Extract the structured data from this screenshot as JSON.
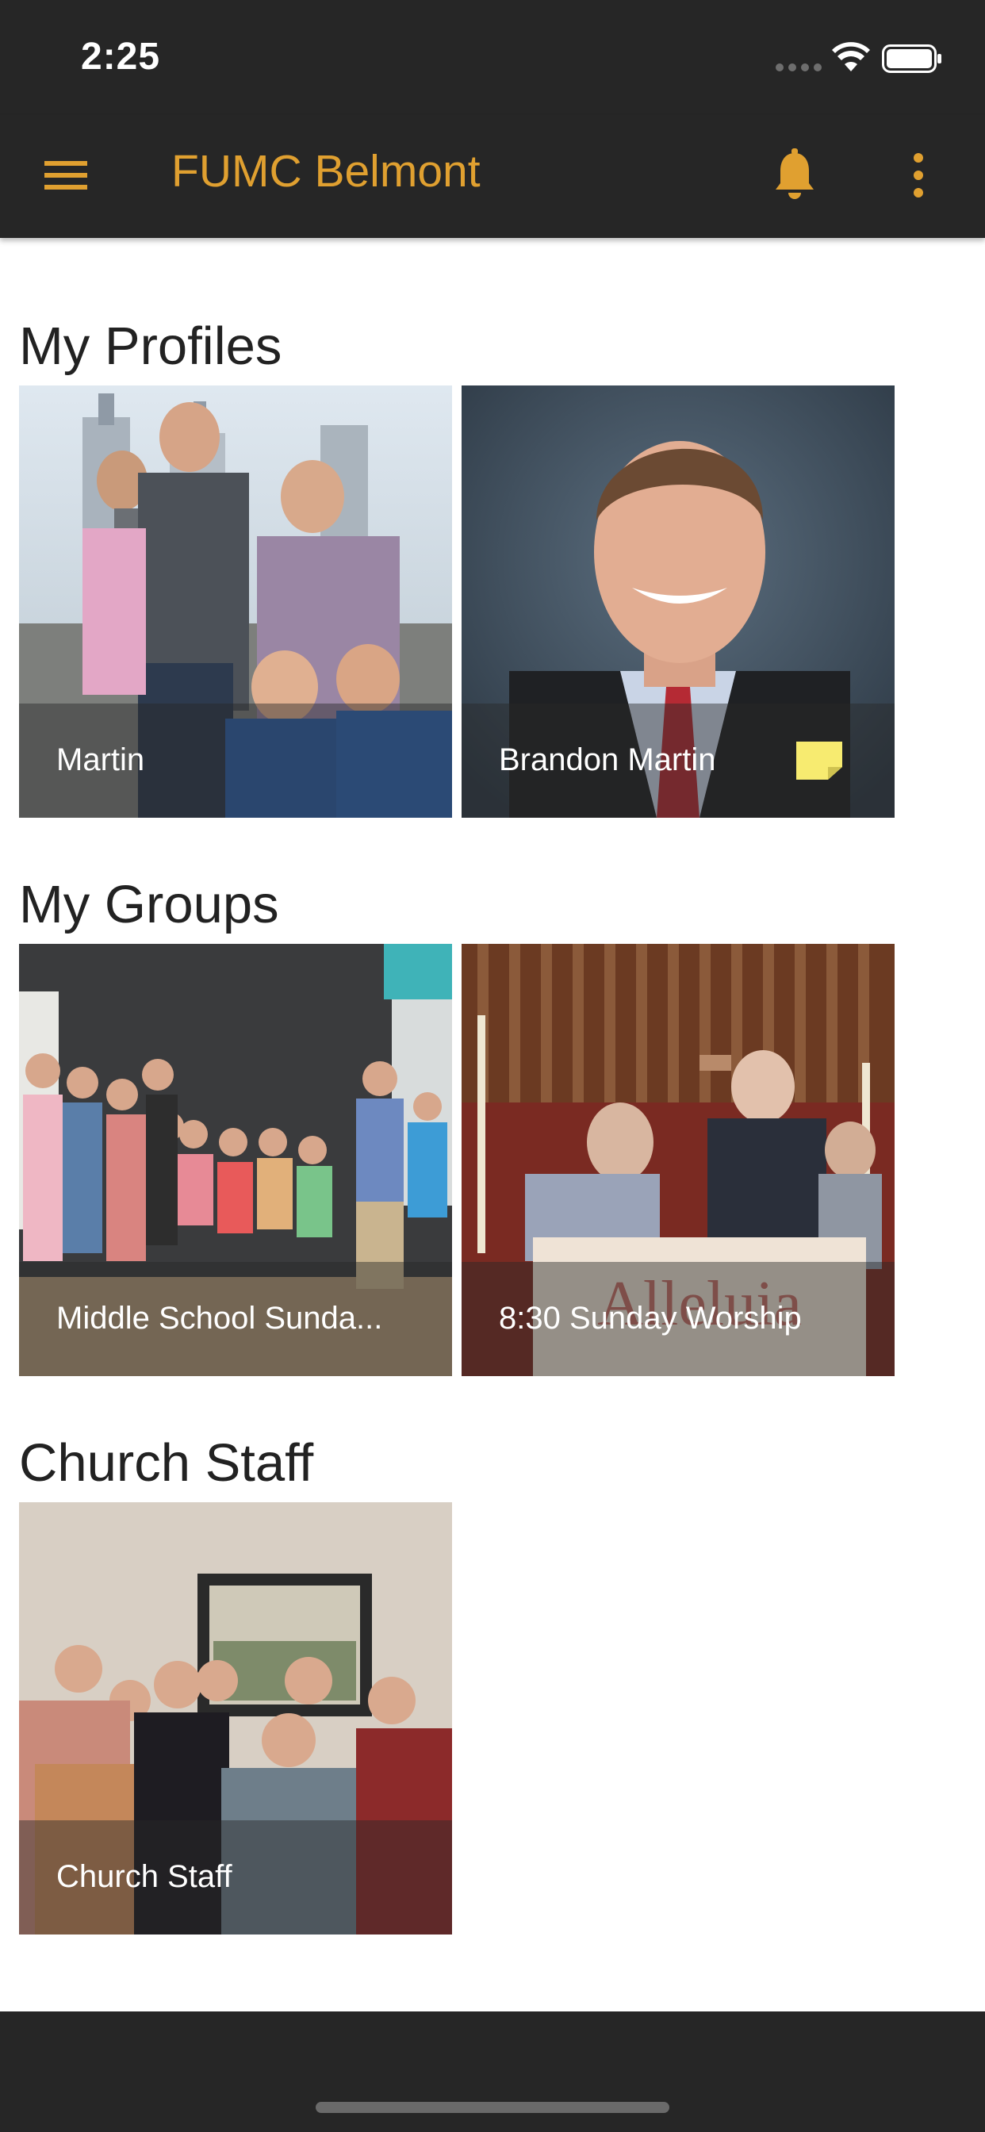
{
  "status_bar": {
    "time": "2:25"
  },
  "app_bar": {
    "title": "FUMC Belmont",
    "accent_color": "#e0a030",
    "icons": [
      "menu-icon",
      "bell-icon",
      "more-vertical-icon"
    ]
  },
  "sections": {
    "profiles": {
      "title": "My Profiles",
      "items": [
        {
          "label": "Martin",
          "image": "family photo at theme park"
        },
        {
          "label": "Brandon Martin",
          "image": "portrait of man in suit",
          "badge_icon": "note-icon",
          "badge_color": "#f7eb70"
        }
      ]
    },
    "groups": {
      "title": "My Groups",
      "items": [
        {
          "label": "Middle School Sunda...",
          "image": "youth group photo"
        },
        {
          "label": "8:30 Sunday Worship",
          "image": "worship service photo"
        }
      ]
    },
    "staff": {
      "title": "Church Staff",
      "items": [
        {
          "label": "Church Staff",
          "image": "staff group photo"
        }
      ]
    }
  }
}
